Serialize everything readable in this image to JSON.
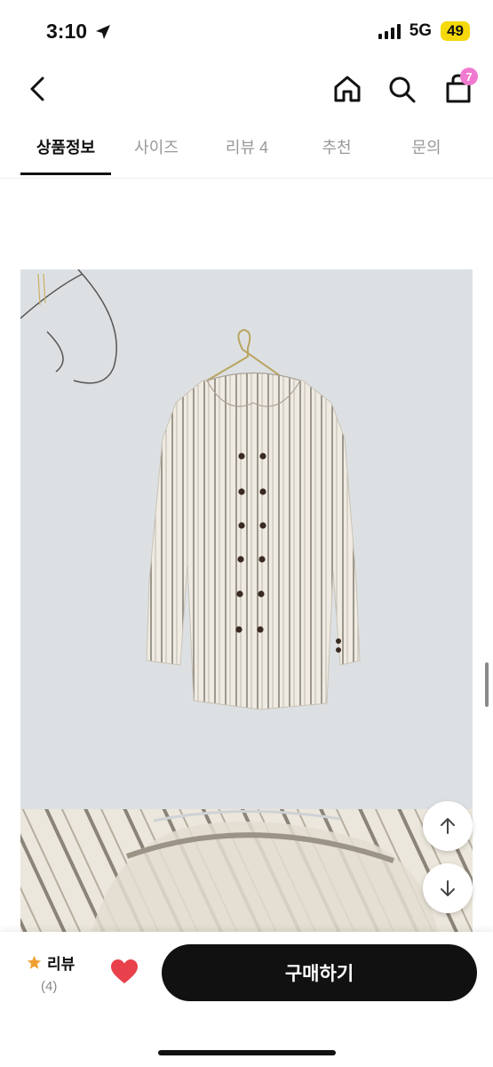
{
  "status_bar": {
    "time": "3:10",
    "network": "5G",
    "battery": "49"
  },
  "header": {
    "cart_count": "7"
  },
  "tabs": [
    {
      "label": "상품정보",
      "active": true
    },
    {
      "label": "사이즈"
    },
    {
      "label": "리뷰 4"
    },
    {
      "label": "추천"
    },
    {
      "label": "문의"
    }
  ],
  "bottom_bar": {
    "review_label": "리뷰",
    "review_count": "(4)",
    "buy_label": "구매하기"
  },
  "colors": {
    "accent": "#111111",
    "badge": "#f07ad0",
    "heart": "#e8414b",
    "star": "#f0a030",
    "battery": "#f5d90a"
  }
}
